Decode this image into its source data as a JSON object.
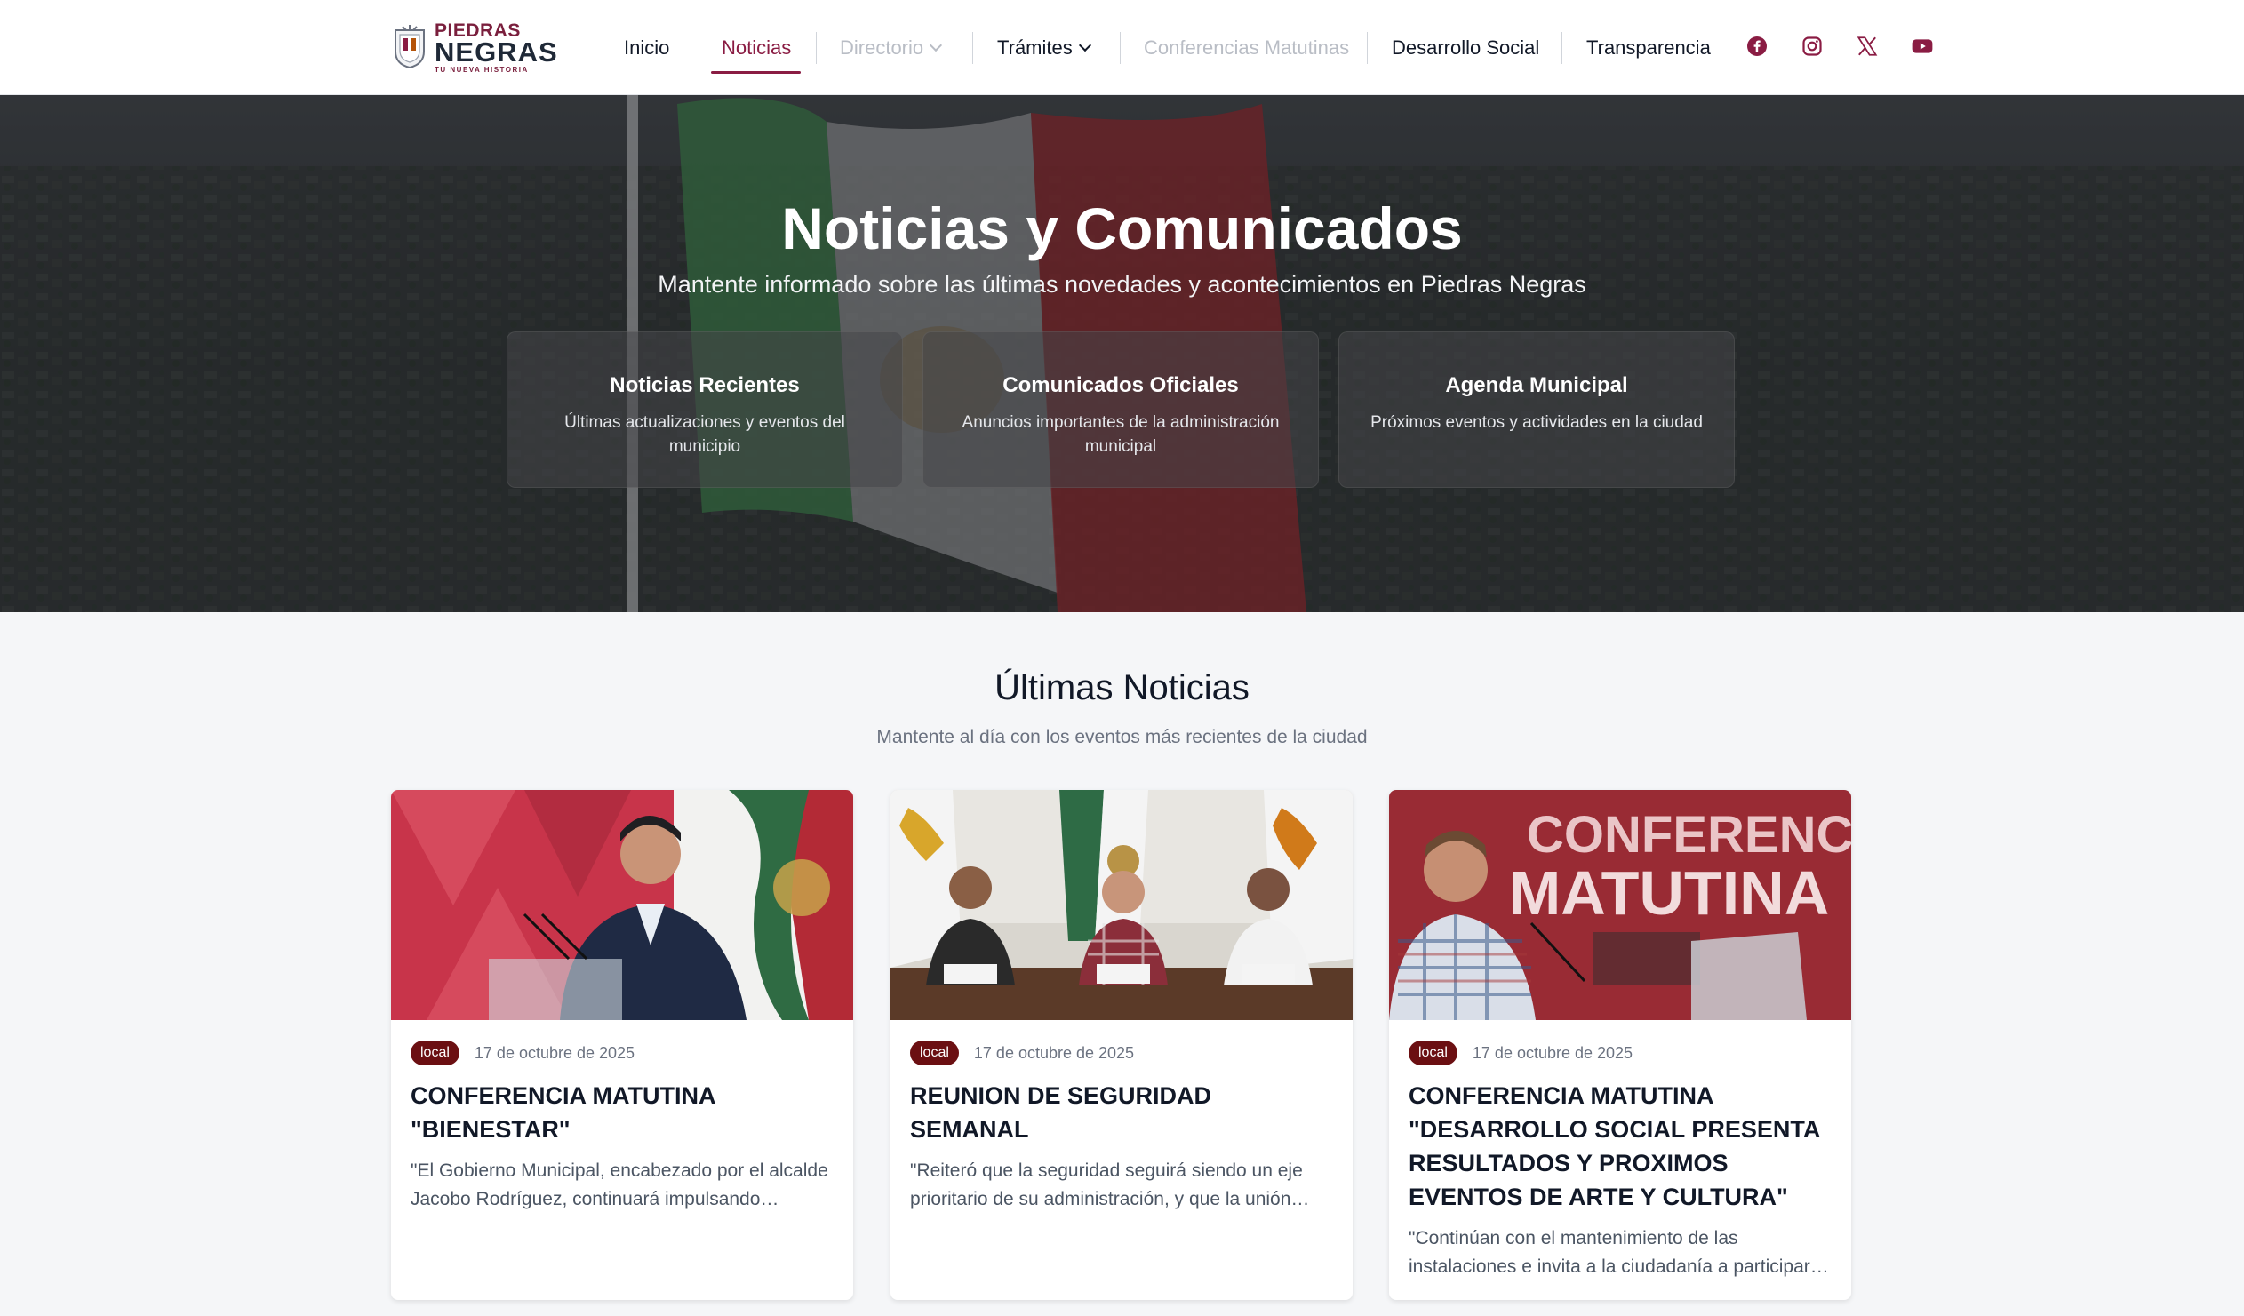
{
  "brand": {
    "line1": "PIEDRAS",
    "line2": "NEGRAS",
    "tagline": "TU NUEVA HISTORIA",
    "color": "#8a1c43"
  },
  "nav": {
    "items": [
      {
        "label": "Inicio",
        "state": "normal"
      },
      {
        "label": "Noticias",
        "state": "active"
      },
      {
        "label": "Directorio",
        "state": "muted",
        "dropdown": true
      },
      {
        "label": "Trámites",
        "state": "normal",
        "dropdown": true
      },
      {
        "label": "Conferencias Matutinas",
        "state": "muted"
      },
      {
        "label": "Desarrollo Social",
        "state": "normal"
      },
      {
        "label": "Transparencia",
        "state": "normal"
      }
    ],
    "social": [
      "facebook-icon",
      "instagram-icon",
      "x-icon",
      "youtube-icon"
    ]
  },
  "hero": {
    "title": "Noticias y Comunicados",
    "subtitle": "Mantente informado sobre las últimas novedades y acontecimientos en Piedras Negras",
    "cards": [
      {
        "title": "Noticias Recientes",
        "text": "Últimas actualizaciones y eventos del municipio"
      },
      {
        "title": "Comunicados Oficiales",
        "text": "Anuncios importantes de la administración municipal"
      },
      {
        "title": "Agenda Municipal",
        "text": "Próximos eventos y actividades en la ciudad"
      }
    ]
  },
  "news": {
    "title": "Últimas Noticias",
    "subtitle": "Mantente al día con los eventos más recientes de la ciudad",
    "cards": [
      {
        "badge": "local",
        "date": "17 de octubre de 2025",
        "title": "CONFERENCIA MATUTINA \"BIENESTAR\"",
        "excerpt": "\"El Gobierno Municipal, encabezado por el alcalde Jacobo Rodríguez, continuará impulsando acciones de bienestar para las familias\""
      },
      {
        "badge": "local",
        "date": "17 de octubre de 2025",
        "title": "REUNION DE SEGURIDAD SEMANAL",
        "excerpt": "\"Reiteró que la seguridad seguirá siendo un eje prioritario de su administración, y que la unión entre corporaciones\""
      },
      {
        "badge": "local",
        "date": "17 de octubre de 2025",
        "title": "CONFERENCIA MATUTINA \"DESARROLLO SOCIAL PRESENTA RESULTADOS Y PROXIMOS EVENTOS DE ARTE Y CULTURA\"",
        "excerpt": "\"Continúan con el mantenimiento de las instalaciones e invita a la ciudadanía a participar en los eventos\""
      }
    ]
  },
  "colors": {
    "accent": "#8a1c43",
    "badge": "#6b0f12",
    "muted_nav": "#b9bdc5"
  }
}
